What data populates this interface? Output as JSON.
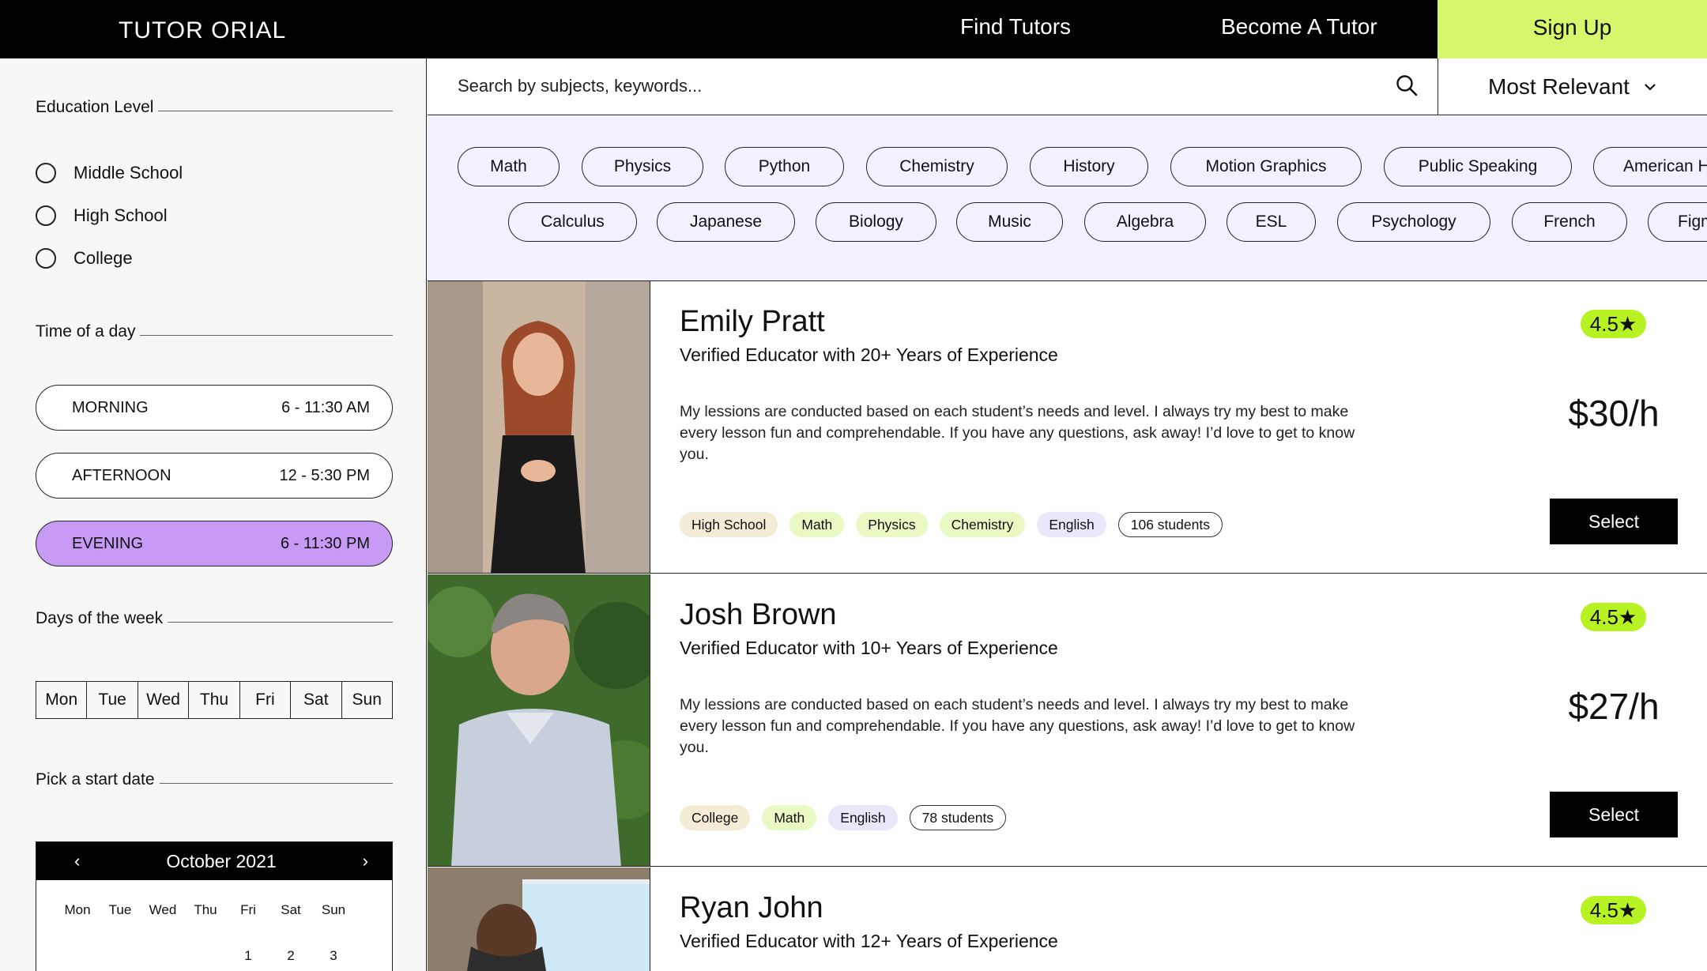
{
  "header": {
    "logo": "TUTOR ORIAL",
    "nav": [
      "Find Tutors",
      "Become A Tutor"
    ],
    "signup": "Sign Up"
  },
  "search": {
    "placeholder": "Search by subjects, keywords..."
  },
  "sort": {
    "label": "Most Relevant"
  },
  "filters": {
    "education": {
      "title": "Education Level",
      "options": [
        "Middle School",
        "High School",
        "College"
      ]
    },
    "time": {
      "title": "Time of a day",
      "slots": [
        {
          "name": "MORNING",
          "range": "6 - 11:30 AM"
        },
        {
          "name": "AFTERNOON",
          "range": "12 - 5:30 PM"
        },
        {
          "name": "EVENING",
          "range": "6 - 11:30 PM"
        }
      ]
    },
    "days": {
      "title": "Days of the week",
      "items": [
        "Mon",
        "Tue",
        "Wed",
        "Thu",
        "Fri",
        "Sat",
        "Sun"
      ]
    },
    "start_date": {
      "title": "Pick a start date",
      "month": "October 2021",
      "weekdays": [
        "Mon",
        "Tue",
        "Wed",
        "Thu",
        "Fri",
        "Sat",
        "Sun"
      ],
      "first_row": [
        "",
        "",
        "",
        "",
        "1",
        "2",
        "3"
      ]
    }
  },
  "subjects": {
    "row1": [
      "Math",
      "Physics",
      "Python",
      "Chemistry",
      "History",
      "Motion Graphics",
      "Public Speaking",
      "American H"
    ],
    "row2": [
      "Calculus",
      "Japanese",
      "Biology",
      "Music",
      "Algebra",
      "ESL",
      "Psychology",
      "French",
      "Figm"
    ]
  },
  "tutors": [
    {
      "name": "Emily Pratt",
      "subtitle": "Verified Educator with 20+ Years of Experience",
      "description": "My lessions are conducted based on each student’s needs and level. I always try my best to make every lesson fun and comprehendable. If you have any questions, ask away! I’d love to get to know you.",
      "tags": [
        "High School",
        "Math",
        "Physics",
        "Chemistry",
        "English"
      ],
      "students": "106 students",
      "rating": "4.5★",
      "price": "$30/h",
      "button": "Select"
    },
    {
      "name": "Josh Brown",
      "subtitle": "Verified Educator with 10+ Years of Experience",
      "description": "My lessions are conducted based on each student’s needs and level. I always try my best to make every lesson fun and comprehendable. If you have any questions, ask away! I’d love to get to know you.",
      "tags": [
        "College",
        "Math",
        "English"
      ],
      "students": "78 students",
      "rating": "4.5★",
      "price": "$27/h",
      "button": "Select"
    },
    {
      "name": "Ryan John",
      "subtitle": "Verified Educator with 12+ Years of Experience",
      "rating": "4.5★"
    }
  ],
  "colors": {
    "accent_lime": "#d6f76c",
    "rating_green": "#b7f222",
    "evening_purple": "#c79af5",
    "chips_bg": "#f1f1ff"
  }
}
